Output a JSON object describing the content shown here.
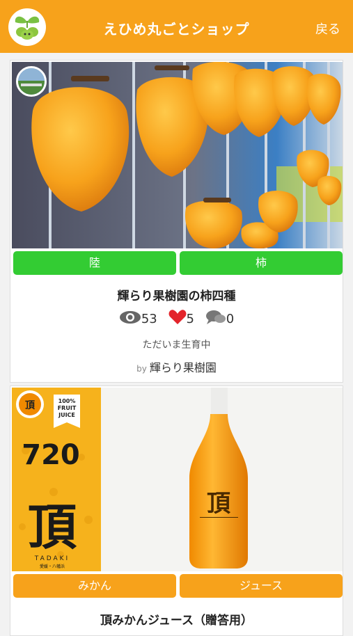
{
  "header": {
    "title": "えひめ丸ごとショップ",
    "back_label": "戻る"
  },
  "cards": [
    {
      "tags": [
        "陸",
        "柿"
      ],
      "title": "輝らり果樹園の柿四種",
      "views": "53",
      "likes": "5",
      "comments": "0",
      "status": "ただいま生育中",
      "by_label": "by",
      "author": "輝らり果樹園"
    },
    {
      "tags": [
        "みかん",
        "ジュース"
      ],
      "title": "頂みかんジュース（贈答用）",
      "product_label": {
        "juice_badge": [
          "100%",
          "FRUIT",
          "JUICE"
        ],
        "volume": "720",
        "brand_kanji": "頂",
        "brand_roman": "TADAKI",
        "brand_sub": "愛媛・八幡浜"
      }
    }
  ]
}
